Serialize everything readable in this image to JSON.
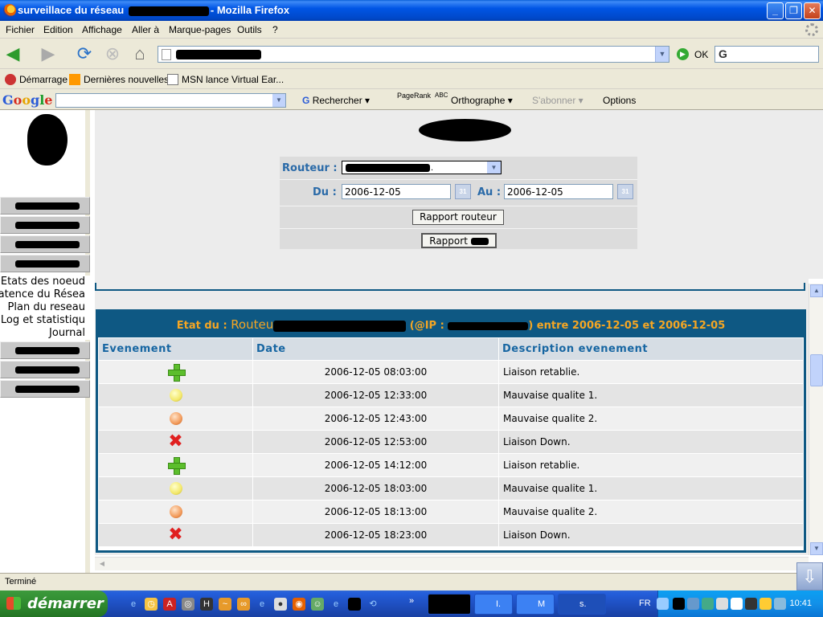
{
  "window": {
    "title": "surveillace du réseau",
    "title_suffix": "- Mozilla Firefox"
  },
  "menu": [
    "Fichier",
    "Edition",
    "Affichage",
    "Aller à",
    "Marque-pages",
    "Outils",
    "?"
  ],
  "nav": {
    "go_label": "OK"
  },
  "bookmarks": [
    "Démarrage",
    "Dernières nouvelles",
    "MSN lance Virtual Ear..."
  ],
  "google_toolbar": {
    "search": "Rechercher",
    "pagerank": "PageRank",
    "abc": "ABC",
    "spell": "Orthographe",
    "subscribe": "S'abonner",
    "options": "Options"
  },
  "sidebar": {
    "links": [
      "Etats des noeud",
      "Latence du Résea",
      "Plan du reseau",
      "Log et statistiqu",
      "Journal"
    ]
  },
  "form": {
    "router_label": "Routeur :",
    "router_value_suffix": ".",
    "from_label": "Du :",
    "from_value": "2006-12-05",
    "to_label": "Au :",
    "to_value": "2006-12-05",
    "cal_icon": "31",
    "btn_router_report": "Rapport routeur",
    "btn_report": "Rapport"
  },
  "report": {
    "caption_prefix": "Etat du :",
    "caption_router": "Routeu",
    "caption_ip": "(@IP :",
    "caption_suffix": ") entre 2006-12-05 et 2006-12-05",
    "columns": [
      "Evenement",
      "Date",
      "Description evenement"
    ],
    "rows": [
      {
        "icon": "plus",
        "date": "2006-12-05 08:03:00",
        "desc": "Liaison retablie."
      },
      {
        "icon": "yellow",
        "date": "2006-12-05 12:33:00",
        "desc": "Mauvaise qualite 1."
      },
      {
        "icon": "orange",
        "date": "2006-12-05 12:43:00",
        "desc": "Mauvaise qualite 2."
      },
      {
        "icon": "x",
        "date": "2006-12-05 12:53:00",
        "desc": "Liaison Down."
      },
      {
        "icon": "plus",
        "date": "2006-12-05 14:12:00",
        "desc": "Liaison retablie."
      },
      {
        "icon": "yellow",
        "date": "2006-12-05 18:03:00",
        "desc": "Mauvaise qualite 1."
      },
      {
        "icon": "orange",
        "date": "2006-12-05 18:13:00",
        "desc": "Mauvaise qualite 2."
      },
      {
        "icon": "x",
        "date": "2006-12-05 18:23:00",
        "desc": "Liaison Down."
      }
    ]
  },
  "status": {
    "text": "Terminé"
  },
  "taskbar": {
    "start": "démarrer",
    "tasks": [
      "I.",
      "M",
      "s."
    ],
    "lang": "FR",
    "clock": "10:41"
  }
}
